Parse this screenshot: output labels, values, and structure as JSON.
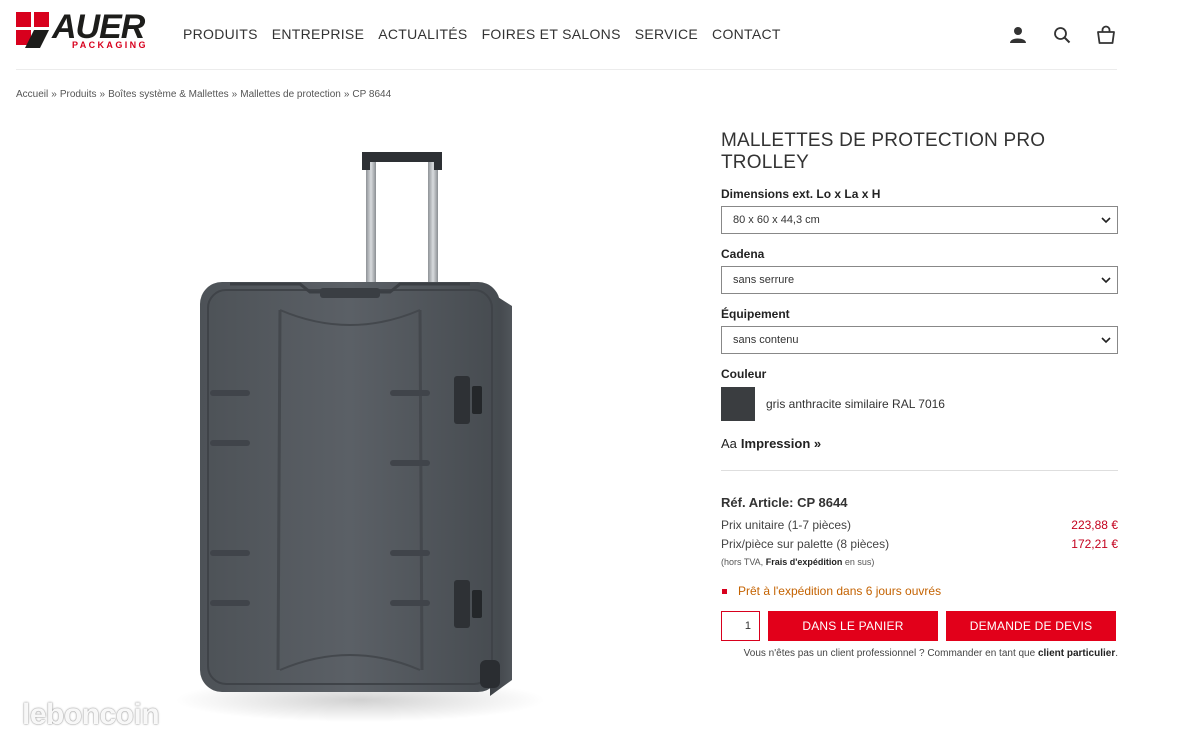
{
  "brand": {
    "name": "AUER",
    "tagline": "PACKAGING",
    "red": "#d8001d"
  },
  "nav": {
    "items": [
      "PRODUITS",
      "ENTREPRISE",
      "ACTUALITÉS",
      "FOIRES ET SALONS",
      "SERVICE",
      "CONTACT"
    ]
  },
  "header_icons": [
    "user-icon",
    "search-icon",
    "cart-icon"
  ],
  "breadcrumb": {
    "items": [
      "Accueil",
      "Produits",
      "Boîtes système & Mallettes",
      "Mallettes de protection",
      "CP 8644"
    ],
    "separator": "»"
  },
  "product": {
    "title": "MALLETTES DE PROTECTION PRO TROLLEY",
    "options": [
      {
        "label": "Dimensions ext. Lo x La x H",
        "value": "80 x 60 x 44,3 cm"
      },
      {
        "label": "Cadena",
        "value": "sans serrure"
      },
      {
        "label": "Équipement",
        "value": "sans contenu"
      }
    ],
    "colour_label": "Couleur",
    "colour_name": "gris anthracite similaire RAL 7016",
    "colour_hex": "#3a3d40",
    "impression_icon_text": "Aa",
    "impression_label": "Impression »",
    "reference": "Réf. Article: CP 8644",
    "prices": [
      {
        "label": "Prix unitaire (1-7 pièces)",
        "value": "223,88 €"
      },
      {
        "label": "Prix/pièce sur palette (8 pièces)",
        "value": "172,21 €"
      }
    ],
    "tax_prefix": "(hors TVA,",
    "tax_link": "Frais d'expédition",
    "tax_suffix": "en sus)",
    "availability": "Prêt à l'expédition dans 6 jours ouvrés",
    "quantity": "1",
    "cart_button": "DANS LE PANIER",
    "quote_button": "DEMANDE DE DEVIS",
    "note_prefix": "Vous n'êtes pas un client professionnel ? Commander en tant que",
    "note_link": "client particulier",
    "note_suffix": "."
  },
  "watermark": "leboncoin"
}
